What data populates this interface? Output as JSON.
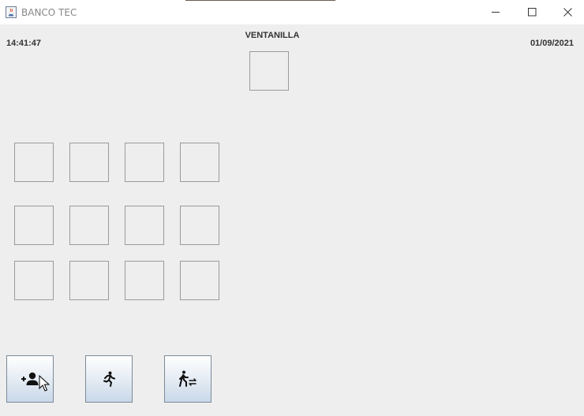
{
  "window": {
    "title": "BANCO TEC",
    "app_icon": "java-cup-icon",
    "controls": [
      "minimize-icon",
      "maximize-icon",
      "close-icon"
    ]
  },
  "header": {
    "time": "14:41:47",
    "label": "VENTANILLA",
    "date": "01/09/2021"
  },
  "toolbar": {
    "buttons": [
      {
        "icon": "add-person-icon"
      },
      {
        "icon": "running-person-icon"
      },
      {
        "icon": "walking-transfer-icon"
      }
    ]
  },
  "colors": {
    "background": "#eeeeee",
    "box_border": "#9a9a9a",
    "button_gradient_top": "#ffffff",
    "button_gradient_bottom": "#c9d8e8"
  }
}
